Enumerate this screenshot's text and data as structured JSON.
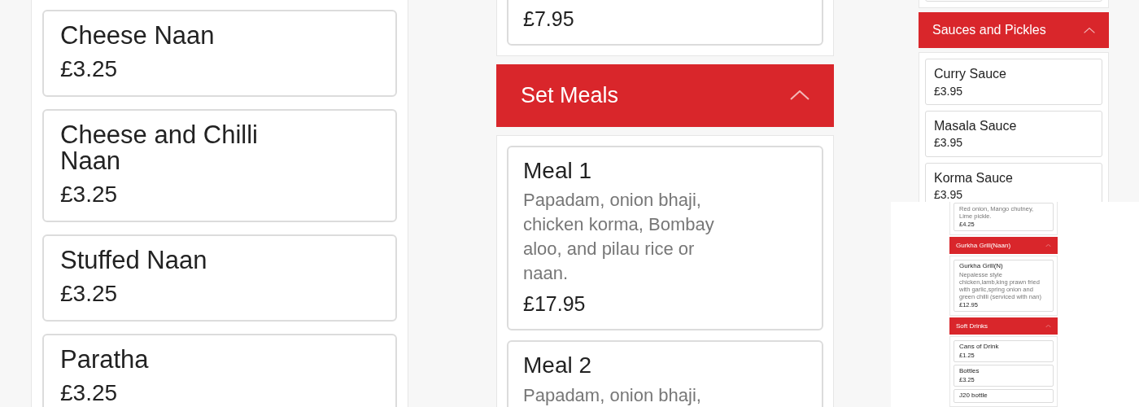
{
  "left_panel": {
    "sections": [
      {
        "items": [
          {
            "name": "Cheese Naan",
            "price": "£3.25"
          },
          {
            "name": "Cheese and Chilli Naan",
            "price": "£3.25"
          },
          {
            "name": "Stuffed Naan",
            "price": "£3.25"
          },
          {
            "name": "Paratha",
            "price": "£3.25"
          }
        ]
      }
    ]
  },
  "middle_panel": {
    "sections": [
      {
        "items": [
          {
            "price": "£7.95"
          }
        ]
      },
      {
        "title": "Set Meals",
        "expanded": true,
        "items": [
          {
            "name": "Meal 1",
            "description": "Papadam, onion bhaji, chicken korma, Bombay aloo, and pilau rice or naan.",
            "price": "£17.95"
          },
          {
            "name": "Meal 2",
            "description": "Papadam, onion bhaji,"
          }
        ]
      }
    ]
  },
  "right_panel": {
    "sections": [
      {
        "stub": true
      },
      {
        "title": "Sauces and Pickles",
        "expanded": true,
        "items": [
          {
            "name": "Curry Sauce",
            "price": "£3.95"
          },
          {
            "name": "Masala Sauce",
            "price": "£3.95"
          },
          {
            "name": "Korma Sauce",
            "price": "£3.95"
          }
        ]
      }
    ]
  },
  "inset_panel": {
    "sections": [
      {
        "items": [
          {
            "description": "Red onion, Mango chutney, Lime pickle.",
            "price": "£4.25"
          }
        ]
      },
      {
        "title": "Gurkha Grill(Naan)",
        "expanded": true,
        "items": [
          {
            "name": "Gurkha Grill(N)",
            "description": "Nepalesse style chicken,lamb,king prawn fried with garlic,spring onion and green chilli (serviced with nan)",
            "price": "£12.95"
          }
        ]
      },
      {
        "title": "Soft Drinks",
        "expanded": true,
        "items": [
          {
            "name": "Cans of Drink",
            "price": "£1.25"
          },
          {
            "name": "Bottles",
            "price": "£3.25"
          },
          {
            "name": "J20 bottle"
          }
        ]
      }
    ]
  }
}
